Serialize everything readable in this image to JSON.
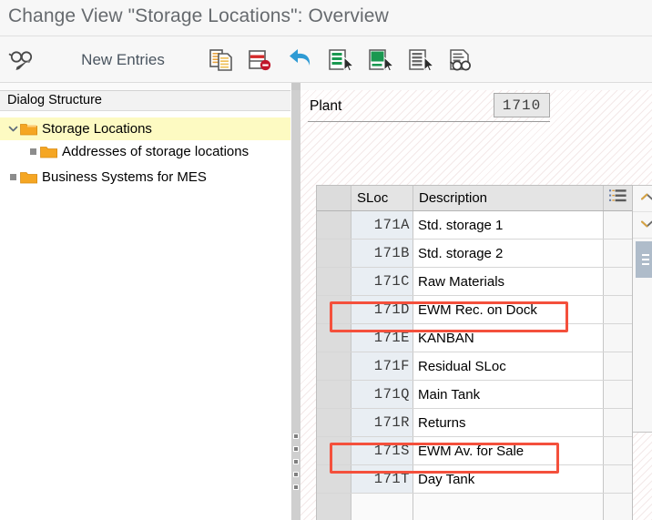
{
  "window": {
    "title": "Change View \"Storage Locations\": Overview"
  },
  "toolbar": {
    "display_change_icon": "glasses-pencil-icon",
    "new_entries_label": "New Entries",
    "items": [
      {
        "name": "copy-as-icon",
        "label": "Copy As"
      },
      {
        "name": "delete-row-icon",
        "label": "Delete"
      },
      {
        "name": "undo-icon",
        "label": "Undo Change"
      },
      {
        "name": "select-all-icon",
        "label": "Select All"
      },
      {
        "name": "select-block-icon",
        "label": "Select Block"
      },
      {
        "name": "deselect-all-icon",
        "label": "Deselect All"
      },
      {
        "name": "details-icon",
        "label": "Details"
      }
    ]
  },
  "sidebar": {
    "header": "Dialog Structure",
    "items": [
      {
        "label": "Storage Locations",
        "level": 0,
        "expanded": true,
        "selected": true,
        "icon": "folder-open-icon"
      },
      {
        "label": "Addresses of storage locations",
        "level": 1,
        "expanded": false,
        "selected": false,
        "icon": "folder-icon"
      },
      {
        "label": "Business Systems for MES",
        "level": 0,
        "expanded": false,
        "selected": false,
        "icon": "folder-icon"
      }
    ]
  },
  "main": {
    "plant": {
      "label": "Plant",
      "value": "1710",
      "placeholder": ""
    },
    "table": {
      "columns": [
        "SLoc",
        "Description"
      ],
      "menu_icon": "table-settings-icon",
      "rows": [
        {
          "sloc": "171A",
          "description": "Std. storage 1",
          "highlighted": false
        },
        {
          "sloc": "171B",
          "description": "Std. storage 2",
          "highlighted": false
        },
        {
          "sloc": "171C",
          "description": "Raw Materials",
          "highlighted": false
        },
        {
          "sloc": "171D",
          "description": "EWM Rec. on Dock",
          "highlighted": true
        },
        {
          "sloc": "171E",
          "description": "KANBAN",
          "highlighted": false
        },
        {
          "sloc": "171F",
          "description": "Residual SLoc",
          "highlighted": false
        },
        {
          "sloc": "171Q",
          "description": "Main Tank",
          "highlighted": false
        },
        {
          "sloc": "171R",
          "description": "Returns",
          "highlighted": false
        },
        {
          "sloc": "171S",
          "description": "EWM Av. for Sale",
          "highlighted": true
        },
        {
          "sloc": "171T",
          "description": "Day Tank",
          "highlighted": false
        },
        {
          "sloc": "",
          "description": "",
          "highlighted": false
        }
      ]
    },
    "scrollbar": {
      "up_icon": "chevron-up-icon",
      "down_icon": "chevron-down-icon",
      "thumb_icon": "scroll-thumb-grip"
    }
  },
  "colors": {
    "title_text": "#666a6e",
    "tree_selected_bg": "#fdfac2",
    "folder": "#f5a623",
    "annotation_red": "#f4503c",
    "sloc_cell_bg": "#e9eef3",
    "scroll_thumb": "#afbcca",
    "undo_blue": "#2f9bd4",
    "icon_green": "#1a9850"
  }
}
